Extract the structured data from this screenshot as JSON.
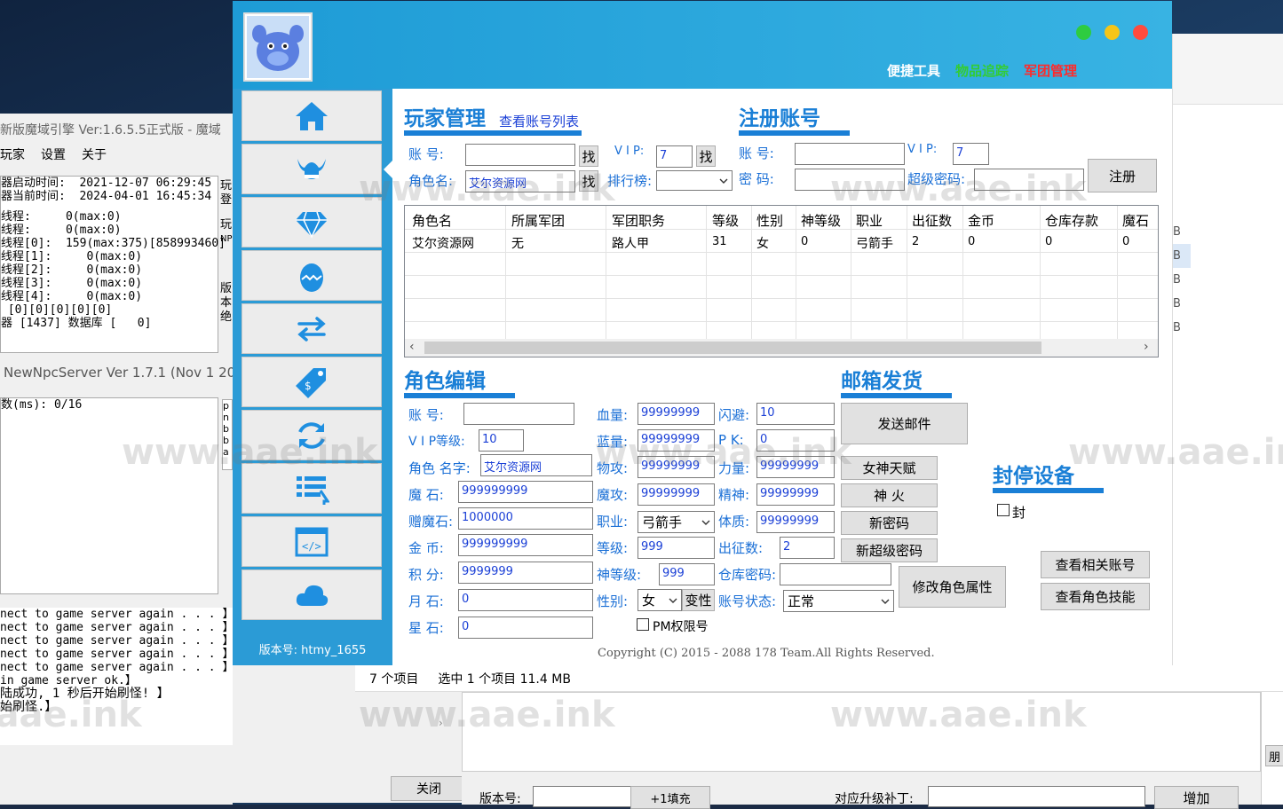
{
  "background_window": {
    "title": "新版魔域引擎 Ver:1.6.5.5正式版 - 魔域",
    "menu": [
      "玩家",
      "设置",
      "关于"
    ],
    "times": [
      "器启动时间:  2021-12-07 06:29:45",
      "器当前时间:  2024-04-01 16:45:34"
    ],
    "threads": [
      "线程:     0(max:0)",
      "线程:     0(max:0)",
      "线程[0]:  159(max:375)[858993460]",
      "线程[1]:     0(max:0)",
      "线程[2]:     0(max:0)",
      "线程[3]:     0(max:0)",
      "线程[4]:     0(max:0)",
      " [0][0][0][0][0]",
      "器 [1437] 数据库 [   0]"
    ],
    "side_fragments": [
      "玩",
      "登",
      "玩",
      "NP",
      "版",
      "本",
      "绝"
    ],
    "npc_title": "NewNpcServer Ver 1.7.1 (Nov  1 20",
    "npc_stat": "数(ms): 0/16",
    "npc_side": [
      "p",
      "n",
      "b",
      "b",
      "a"
    ],
    "log": [
      "nect to game server again . . . 】",
      "nect to game server again . . . 】",
      "nect to game server again . . . 】",
      "nect to game server again . . . 】",
      "nect to game server again . . . 】",
      "in game server ok.】",
      "陆成功, 1 秒后开始刷怪! 】",
      "始刷怪.】"
    ],
    "close_button": "关闭"
  },
  "explorer": {
    "status_items": "7 个项目",
    "status_selected": "选中 1 个项目  11.4 MB",
    "right_letters": [
      "B",
      "B",
      "B",
      "B",
      "B"
    ],
    "right_fragment": "朋",
    "version_label": "版本号:",
    "fill_button": "+1填充",
    "patch_label": "对应升级补丁:",
    "add_button": "增加"
  },
  "watermark": "www.aae.ink",
  "app": {
    "top_links": [
      {
        "label": "便捷工具",
        "color": "#ffffff"
      },
      {
        "label": "物品追踪",
        "color": "#33cc33"
      },
      {
        "label": "军团管理",
        "color": "#ff2a2a"
      }
    ],
    "window_dots": [
      "#2ecc40",
      "#f5c518",
      "#ff4b3e"
    ],
    "version": "版本号: htmy_1655",
    "player": {
      "title": "玩家管理",
      "link": "查看账号列表",
      "account_label": "账  号:",
      "account_value": "",
      "find1": "找",
      "vip_label": "V I P:",
      "vip_value": "7",
      "find2": "找",
      "role_label": "角色名:",
      "role_value": "艾尔资源网",
      "find3": "找",
      "rank_label": "排行榜:",
      "rank_value": ""
    },
    "register": {
      "title": "注册账号",
      "account_label": "账  号:",
      "account_value": "",
      "vip_label": "V I P:",
      "vip_value": "7",
      "password_label": "密  码:",
      "password_value": "",
      "superpass_label": "超级密码:",
      "superpass_value": "",
      "button": "注册"
    },
    "table": {
      "headers": [
        "角色名",
        "所属军团",
        "军团职务",
        "等级",
        "性别",
        "神等级",
        "职业",
        "出征数",
        "金币",
        "仓库存款",
        "魔石"
      ],
      "rows": [
        [
          "艾尔资源网",
          "无",
          "路人甲",
          "31",
          "女",
          "0",
          "弓箭手",
          "2",
          "0",
          "0",
          "0"
        ]
      ]
    },
    "edit": {
      "title": "角色编辑",
      "fields": [
        {
          "label": "账   号:",
          "value": ""
        },
        {
          "label": "V I P等级:",
          "value": "10"
        },
        {
          "label": "角色 名字:",
          "value": "艾尔资源网"
        },
        {
          "label": "魔   石:",
          "value": "999999999"
        },
        {
          "label": "赠魔石:",
          "value": "1000000"
        },
        {
          "label": "金   币:",
          "value": "999999999"
        },
        {
          "label": "积   分:",
          "value": "9999999"
        },
        {
          "label": "月   石:",
          "value": "0"
        },
        {
          "label": "星   石:",
          "value": "0"
        }
      ],
      "mid": [
        {
          "label": "血量:",
          "value": "99999999"
        },
        {
          "label": "蓝量:",
          "value": "99999999"
        },
        {
          "label": "物攻:",
          "value": "99999999"
        },
        {
          "label": "魔攻:",
          "value": "99999999"
        },
        {
          "label": "职业:",
          "value": "弓箭手"
        },
        {
          "label": "等级:",
          "value": "999"
        },
        {
          "label": "神等级:",
          "value": "999"
        },
        {
          "label": "性别:",
          "value": "女"
        }
      ],
      "right": [
        {
          "label": "闪避:",
          "value": "10"
        },
        {
          "label": "P  K:",
          "value": "0"
        },
        {
          "label": "力量:",
          "value": "99999999"
        },
        {
          "label": "精神:",
          "value": "99999999"
        },
        {
          "label": "体质:",
          "value": "99999999"
        },
        {
          "label": "出征数:",
          "value": "2"
        },
        {
          "label": "仓库密码:",
          "value": ""
        },
        {
          "label": "账号状态:",
          "value": "正常"
        }
      ],
      "gender_button": "变性",
      "pm_checkbox": "PM权限号",
      "modify_button": "修改角色属性"
    },
    "mail": {
      "title": "邮箱发货",
      "send_button": "发送邮件",
      "buttons": [
        "女神天赋",
        "神  火",
        "新密码",
        "新超级密码"
      ]
    },
    "ban": {
      "title": "封停设备",
      "checkbox": "封",
      "related_button": "查看相关账号",
      "skills_button": "查看角色技能"
    },
    "copyright": "Copyright (C) 2015 - 2088 178 Team.All Rights Reserved."
  }
}
